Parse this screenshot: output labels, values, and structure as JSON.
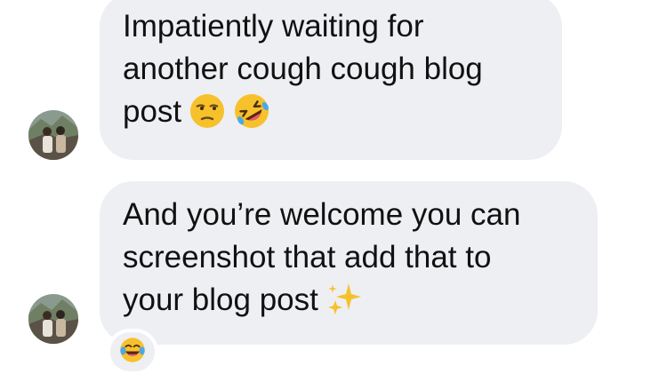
{
  "messages": [
    {
      "lines": [
        "Impatiently waiting for",
        "another cough cough blog",
        "post"
      ],
      "trailing_emojis": [
        "unamused-face-emoji",
        "rolling-on-floor-laughing-emoji"
      ]
    },
    {
      "lines": [
        "And you’re welcome you can",
        "screenshot that add that to",
        "your blog post"
      ],
      "trailing_emojis": [
        "sparkles-emoji"
      ],
      "reaction": "face-with-tears-of-joy-emoji"
    }
  ],
  "colors": {
    "bubble_background": "#eeeff3",
    "text": "#111111",
    "emoji_yellow": "#f7c12c",
    "tear_blue": "#4aa8e8"
  }
}
